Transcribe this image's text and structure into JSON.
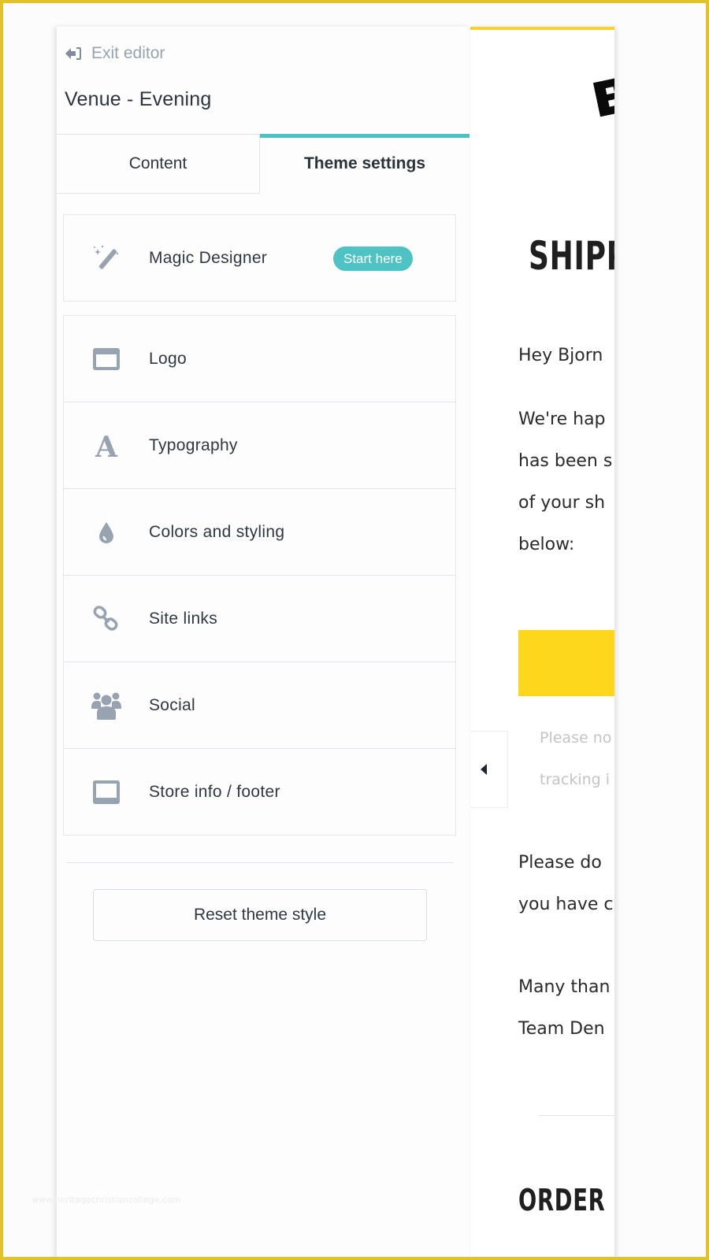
{
  "editor": {
    "exit_label": "Exit editor",
    "exit_icon": "sign-out-icon",
    "title": "Venue - Evening",
    "tabs": [
      {
        "label": "Content",
        "active": false
      },
      {
        "label": "Theme settings",
        "active": true
      }
    ],
    "magic": {
      "label": "Magic Designer",
      "icon": "magic-wand-icon",
      "badge": "Start here"
    },
    "items": [
      {
        "label": "Logo",
        "icon": "window-icon"
      },
      {
        "label": "Typography",
        "icon": "font-icon"
      },
      {
        "label": "Colors and styling",
        "icon": "droplet-icon"
      },
      {
        "label": "Site links",
        "icon": "link-icon"
      },
      {
        "label": "Social",
        "icon": "users-icon"
      },
      {
        "label": "Store info / footer",
        "icon": "monitor-icon"
      }
    ],
    "reset_label": "Reset theme style",
    "colors": {
      "accent": "#4ac2c3",
      "icon": "#97a3b1",
      "text": "#2f3842"
    }
  },
  "preview": {
    "heading": "SHIPP",
    "greeting": "Hey Bjorn",
    "body_lines": [
      "We're hap",
      "has been s",
      "of your sh",
      "below:"
    ],
    "note_lines": [
      "Please no",
      "tracking i"
    ],
    "closing_lines": [
      "Please do",
      "you have c"
    ],
    "signoff_lines": [
      "Many than",
      "Team Den"
    ],
    "order_heading": "ORDER N",
    "colors": {
      "topbar": "#f5d230",
      "cta": "#fdd71b"
    }
  },
  "collapse_toggle": {
    "icon": "caret-left-icon"
  },
  "watermark": "www.heritagechristiancollege.com"
}
